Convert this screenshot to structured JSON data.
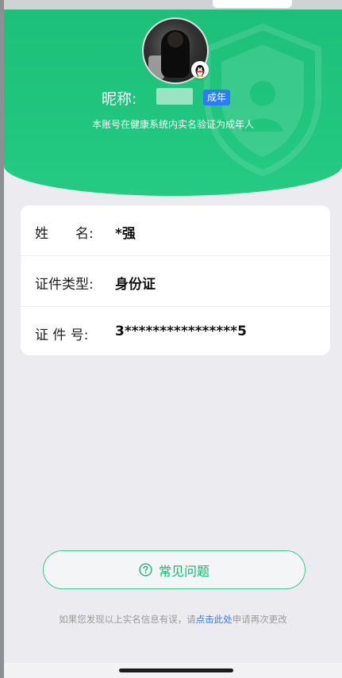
{
  "profile": {
    "nickname_label": "昵称:",
    "adult_badge": "成年",
    "verify_text": "本账号在健康系统内实名验证为成年人"
  },
  "identity": {
    "rows": [
      {
        "label": "姓　　名:",
        "value": "*强"
      },
      {
        "label": "证件类型:",
        "value": "身份证"
      },
      {
        "label": "证 件 号:",
        "value": "3****************5"
      }
    ]
  },
  "faq": {
    "label": "常见问题",
    "icon": "question-circle-icon"
  },
  "footer": {
    "prefix": "如果您发现以上实名信息有误，请",
    "link": "点击此处",
    "suffix": "申请再次更改"
  },
  "colors": {
    "brand_green": "#20c57e",
    "link_blue": "#2c7df5"
  }
}
